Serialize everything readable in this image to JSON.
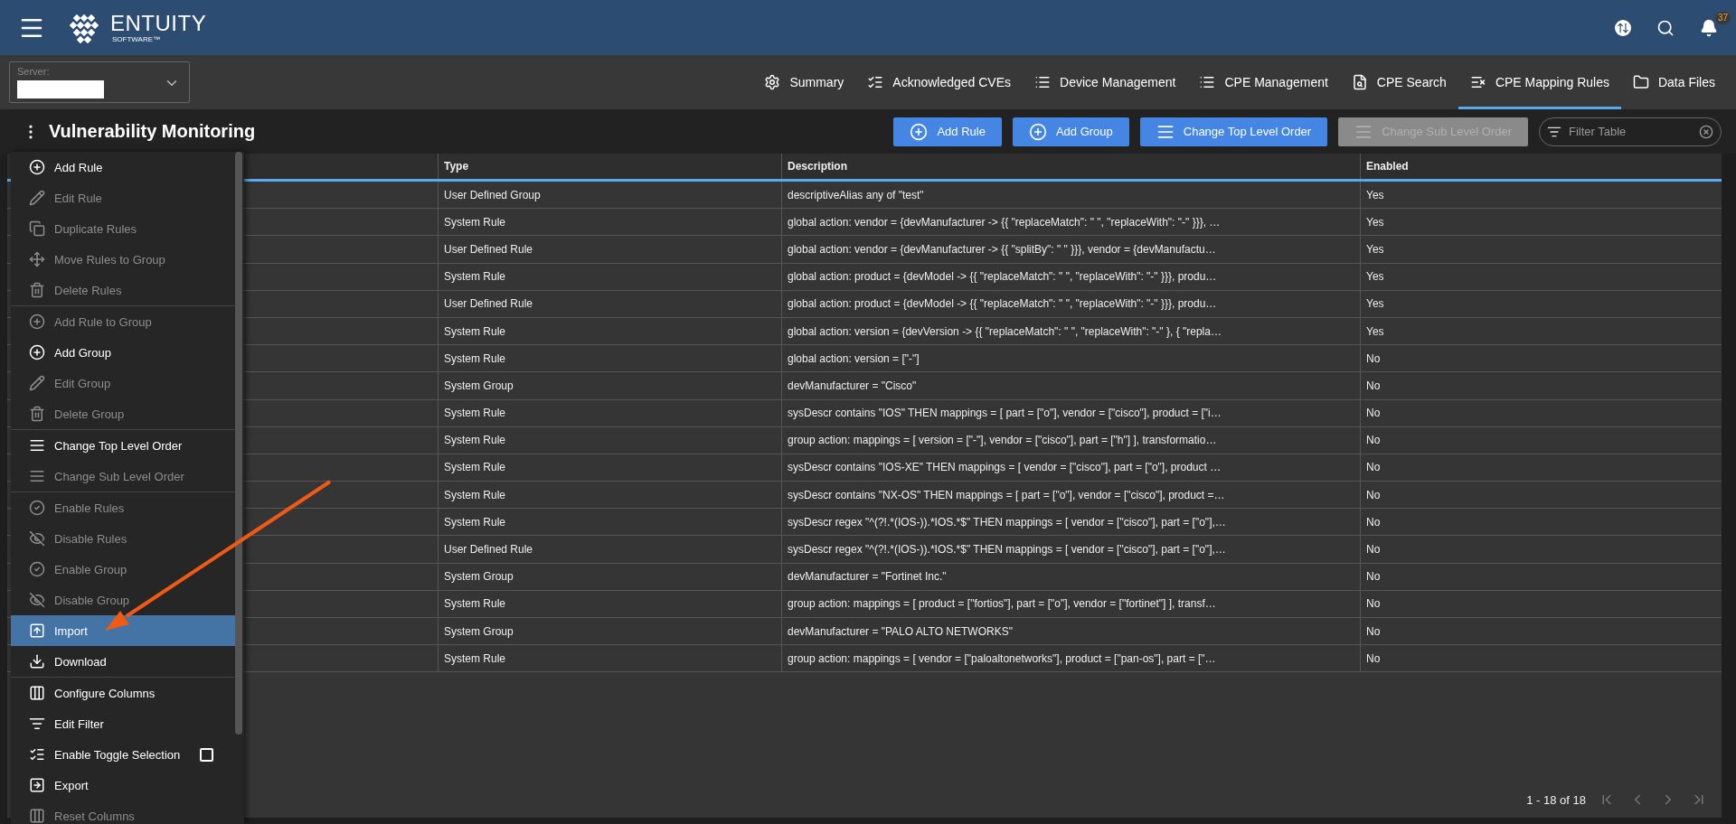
{
  "header": {
    "logo": {
      "name": "ENTUITY",
      "tagline": "SOFTWARE™"
    },
    "notifications": {
      "count": "37"
    }
  },
  "server": {
    "label": "Server:"
  },
  "tabs": [
    {
      "label": "Summary",
      "kind": "gear",
      "selected": false
    },
    {
      "label": "Acknowledged CVEs",
      "kind": "checklist",
      "selected": false
    },
    {
      "label": "Device Management",
      "kind": "list",
      "selected": false
    },
    {
      "label": "CPE Management",
      "kind": "list",
      "selected": false
    },
    {
      "label": "CPE Search",
      "kind": "search",
      "selected": false
    },
    {
      "label": "CPE Mapping Rules",
      "kind": "mapping",
      "selected": true
    },
    {
      "label": "Data Files",
      "kind": "folder",
      "selected": false
    }
  ],
  "page_title": "Vulnerability Monitoring",
  "toolbar": {
    "buttons": [
      {
        "label": "Add Rule",
        "kind": "add",
        "disabled": false
      },
      {
        "label": "Add Group",
        "kind": "add",
        "disabled": false
      },
      {
        "label": "Change Top Level Order",
        "kind": "order",
        "disabled": false
      },
      {
        "label": "Change Sub Level Order",
        "kind": "order",
        "disabled": true
      }
    ],
    "filter": {
      "placeholder": "Filter Table"
    }
  },
  "table": {
    "columns": [
      "Type",
      "Description",
      "Enabled"
    ],
    "rows": [
      [
        "User Defined Group",
        "descriptiveAlias any of \"test\"",
        "Yes"
      ],
      [
        "System Rule",
        "global action: vendor = {devManufacturer -> {{ \"replaceMatch\": \" \", \"replaceWith\": \"-\" }}}, …",
        "Yes"
      ],
      [
        "User Defined Rule",
        "global action: vendor = {devManufacturer -> {{ \"splitBy\": \" \" }}}, vendor = {devManufactu…",
        "Yes"
      ],
      [
        "System Rule",
        "global action: product = {devModel -> {{ \"replaceMatch\": \" \", \"replaceWith\": \"-\" }}}, produ…",
        "Yes"
      ],
      [
        "User Defined Rule",
        "global action: product = {devModel -> {{ \"replaceMatch\": \" \", \"replaceWith\": \"-\" }}}, produ…",
        "Yes"
      ],
      [
        "System Rule",
        "global action: version = {devVersion -> {{ \"replaceMatch\": \" \", \"replaceWith\": \"-\" }, { \"repla…",
        "Yes"
      ],
      [
        "System Rule",
        "global action: version = [\"-\"]",
        "No"
      ],
      [
        "System Group",
        "devManufacturer = \"Cisco\"",
        "No"
      ],
      [
        "System Rule",
        "sysDescr contains \"IOS\" THEN mappings = [ part = [\"o\"], vendor = [\"cisco\"], product = [\"i…",
        "No"
      ],
      [
        "System Rule",
        "group action: mappings = [ version = [\"-\"], vendor = [\"cisco\"], part = [\"h\"] ], transformatio…",
        "No"
      ],
      [
        "System Rule",
        "sysDescr contains \"IOS-XE\" THEN mappings = [ vendor = [\"cisco\"], part = [\"o\"], product …",
        "No"
      ],
      [
        "System Rule",
        "sysDescr contains \"NX-OS\" THEN mappings = [ part = [\"o\"], vendor = [\"cisco\"], product =…",
        "No"
      ],
      [
        "System Rule",
        "sysDescr regex \"^(?!.*(IOS-)).*IOS.*$\" THEN mappings = [ vendor = [\"cisco\"], part = [\"o\"],…",
        "No"
      ],
      [
        "User Defined Rule",
        "sysDescr regex \"^(?!.*(IOS-)).*IOS.*$\" THEN mappings = [ vendor = [\"cisco\"], part = [\"o\"],…",
        "No"
      ],
      [
        "System Group",
        "devManufacturer = \"Fortinet Inc.\"",
        "No"
      ],
      [
        "System Rule",
        "group action: mappings = [ product = [\"fortios\"], part = [\"o\"], vendor = [\"fortinet\"] ], transf…",
        "No"
      ],
      [
        "System Group",
        "devManufacturer = \"PALO ALTO NETWORKS\"",
        "No"
      ],
      [
        "System Rule",
        "group action: mappings = [ vendor = [\"paloaltonetworks\"], product = [\"pan-os\"], part = [\"…",
        "No"
      ]
    ],
    "pagination": "1 - 18 of 18"
  },
  "menu": {
    "groups": [
      [
        {
          "label": "Add Rule",
          "kind": "add",
          "disabled": false,
          "selected": false
        },
        {
          "label": "Edit Rule",
          "kind": "edit",
          "disabled": true,
          "selected": false
        },
        {
          "label": "Duplicate Rules",
          "kind": "copy",
          "disabled": true,
          "selected": false
        },
        {
          "label": "Move Rules to Group",
          "kind": "move",
          "disabled": true,
          "selected": false
        },
        {
          "label": "Delete Rules",
          "kind": "delete",
          "disabled": true,
          "selected": false
        }
      ],
      [
        {
          "label": "Add Rule to Group",
          "kind": "add",
          "disabled": true,
          "selected": false
        },
        {
          "label": "Add Group",
          "kind": "add",
          "disabled": false,
          "selected": false
        },
        {
          "label": "Edit Group",
          "kind": "edit",
          "disabled": true,
          "selected": false
        },
        {
          "label": "Delete Group",
          "kind": "delete",
          "disabled": true,
          "selected": false
        }
      ],
      [
        {
          "label": "Change Top Level Order",
          "kind": "order",
          "disabled": false,
          "selected": false
        },
        {
          "label": "Change Sub Level Order",
          "kind": "order",
          "disabled": true,
          "selected": false
        }
      ],
      [
        {
          "label": "Enable Rules",
          "kind": "enable",
          "disabled": true,
          "selected": false
        },
        {
          "label": "Disable Rules",
          "kind": "disable",
          "disabled": true,
          "selected": false
        },
        {
          "label": "Enable Group",
          "kind": "enable",
          "disabled": true,
          "selected": false
        },
        {
          "label": "Disable Group",
          "kind": "disable",
          "disabled": true,
          "selected": false
        },
        {
          "label": "Import",
          "kind": "import",
          "disabled": false,
          "selected": true
        },
        {
          "label": "Download",
          "kind": "download",
          "disabled": false,
          "selected": false
        }
      ],
      [
        {
          "label": "Configure Columns",
          "kind": "columns",
          "disabled": false,
          "selected": false
        },
        {
          "label": "Edit Filter",
          "kind": "filter",
          "disabled": false,
          "selected": false
        },
        {
          "label": "Enable Toggle Selection",
          "kind": "toggle",
          "disabled": false,
          "selected": false,
          "checked": false
        },
        {
          "label": "Export",
          "kind": "export",
          "disabled": false,
          "selected": false
        },
        {
          "label": "Reset Columns",
          "kind": "columns",
          "disabled": true,
          "selected": false
        }
      ]
    ]
  }
}
